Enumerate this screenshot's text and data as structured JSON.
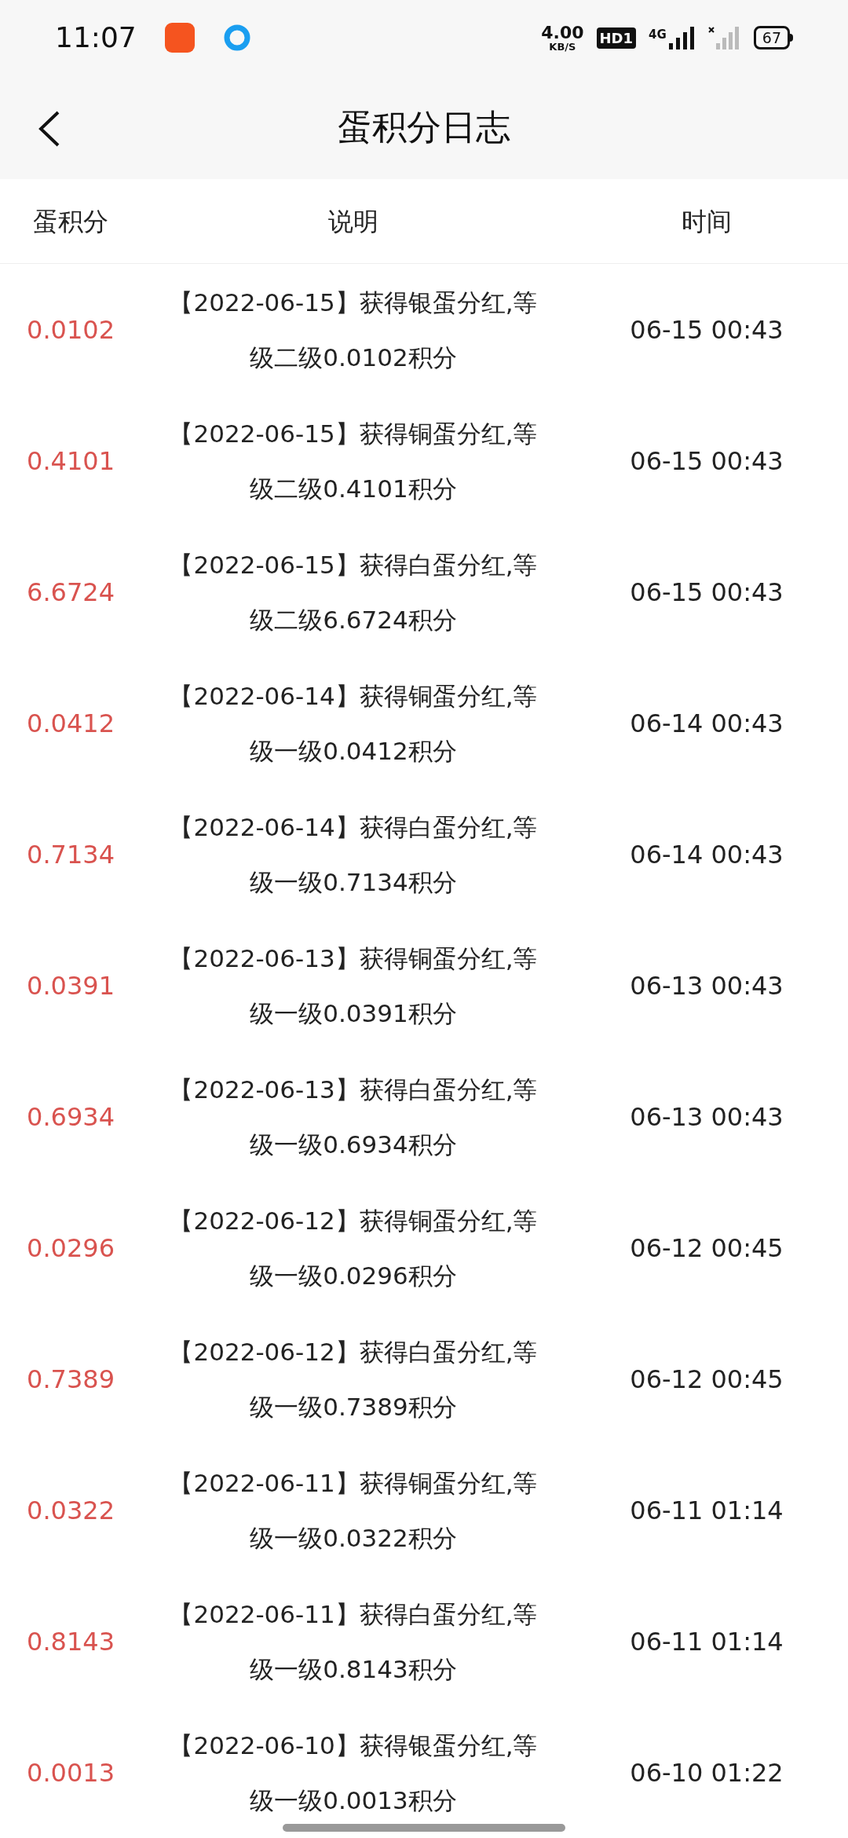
{
  "status_bar": {
    "time": "11:07",
    "speed": "4.00",
    "speed_unit": "KB/S",
    "hd": "HD1",
    "network": "4G",
    "battery": "67"
  },
  "header": {
    "title": "蛋积分日志"
  },
  "table": {
    "columns": [
      "蛋积分",
      "说明",
      "时间"
    ],
    "rows": [
      {
        "points": "0.0102",
        "desc": "【2022-06-15】获得银蛋分红,等级二级0.0102积分",
        "time": "06-15 00:43"
      },
      {
        "points": "0.4101",
        "desc": "【2022-06-15】获得铜蛋分红,等级二级0.4101积分",
        "time": "06-15 00:43"
      },
      {
        "points": "6.6724",
        "desc": "【2022-06-15】获得白蛋分红,等级二级6.6724积分",
        "time": "06-15 00:43"
      },
      {
        "points": "0.0412",
        "desc": "【2022-06-14】获得铜蛋分红,等级一级0.0412积分",
        "time": "06-14 00:43"
      },
      {
        "points": "0.7134",
        "desc": "【2022-06-14】获得白蛋分红,等级一级0.7134积分",
        "time": "06-14 00:43"
      },
      {
        "points": "0.0391",
        "desc": "【2022-06-13】获得铜蛋分红,等级一级0.0391积分",
        "time": "06-13 00:43"
      },
      {
        "points": "0.6934",
        "desc": "【2022-06-13】获得白蛋分红,等级一级0.6934积分",
        "time": "06-13 00:43"
      },
      {
        "points": "0.0296",
        "desc": "【2022-06-12】获得铜蛋分红,等级一级0.0296积分",
        "time": "06-12 00:45"
      },
      {
        "points": "0.7389",
        "desc": "【2022-06-12】获得白蛋分红,等级一级0.7389积分",
        "time": "06-12 00:45"
      },
      {
        "points": "0.0322",
        "desc": "【2022-06-11】获得铜蛋分红,等级一级0.0322积分",
        "time": "06-11 01:14"
      },
      {
        "points": "0.8143",
        "desc": "【2022-06-11】获得白蛋分红,等级一级0.8143积分",
        "time": "06-11 01:14"
      },
      {
        "points": "0.0013",
        "desc": "【2022-06-10】获得银蛋分红,等级一级0.0013积分",
        "time": "06-10 01:22"
      }
    ]
  }
}
